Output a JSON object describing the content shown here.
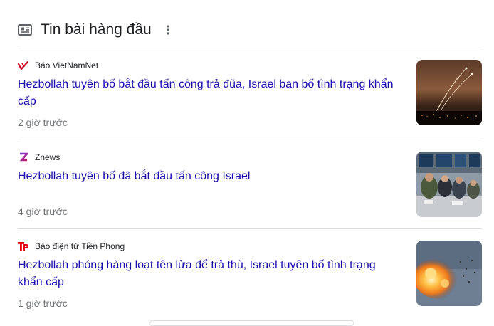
{
  "header": {
    "title": "Tin bài hàng đầu",
    "icon": "news-icon",
    "more_icon": "more-vert-icon"
  },
  "articles": [
    {
      "source": "Báo VietNamNet",
      "logo_icon": "vietnamnet-logo-icon",
      "headline": "Hezbollah tuyên bố bắt đầu tấn công trả đũa, Israel ban bố tình trạng khẩn cấp",
      "time": "2 giờ trước"
    },
    {
      "source": "Znews",
      "logo_icon": "znews-logo-icon",
      "headline": "Hezbollah tuyên bố đã bắt đầu tấn công Israel",
      "time": "4 giờ trước"
    },
    {
      "source": "Báo điện tử Tiền Phong",
      "logo_icon": "tienphong-logo-icon",
      "headline": "Hezbollah phóng hàng loạt tên lửa để trả thù, Israel tuyên bố tình trạng khẩn cấp",
      "time": "1 giờ trước"
    }
  ],
  "colors": {
    "link": "#1a0dab",
    "text": "#202124",
    "muted": "#70757a",
    "divider": "#dadce0"
  }
}
